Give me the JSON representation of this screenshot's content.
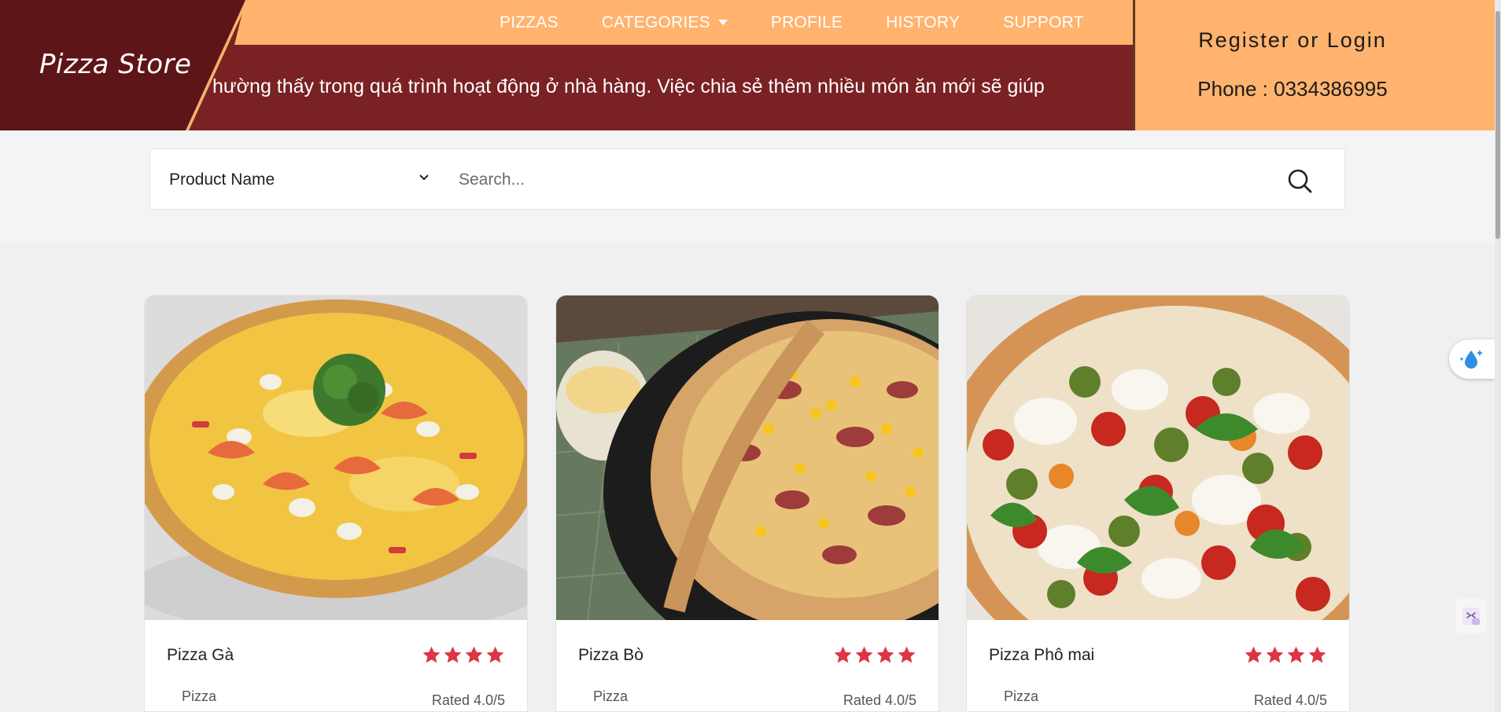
{
  "brand": {
    "logo": "Pizza Store"
  },
  "nav": {
    "items": [
      {
        "label": "PIZZAS"
      },
      {
        "label": "CATEGORIES"
      },
      {
        "label": "PROFILE"
      },
      {
        "label": "HISTORY"
      },
      {
        "label": "SUPPORT"
      }
    ]
  },
  "marquee": {
    "text": "hường thấy trong quá trình hoạt động ở nhà hàng. Việc chia sẻ thêm nhiều món ăn mới sẽ giúp"
  },
  "account": {
    "register_label": "Register or Login",
    "phone_label": "Phone : 0334386995"
  },
  "search": {
    "filter_value": "Product Name",
    "placeholder": "Search..."
  },
  "products": [
    {
      "name": "Pizza Gà",
      "category": "Pizza",
      "rated": "Rated 4.0/5",
      "stars": 4
    },
    {
      "name": "Pizza Bò",
      "category": "Pizza",
      "rated": "Rated 4.0/5",
      "stars": 4
    },
    {
      "name": "Pizza Phô mai",
      "category": "Pizza",
      "rated": "Rated 4.0/5",
      "stars": 4
    }
  ],
  "colors": {
    "brand_red": "#7a2124",
    "brand_dark": "#5e1517",
    "accent_orange": "#ffb36e",
    "star_red": "#dc3545"
  },
  "icons": {
    "search": "search-icon",
    "chevron": "chevron-down-icon",
    "caret": "caret-down-icon",
    "star": "star-icon",
    "drop": "water-drop-icon",
    "code": "code-icon"
  }
}
